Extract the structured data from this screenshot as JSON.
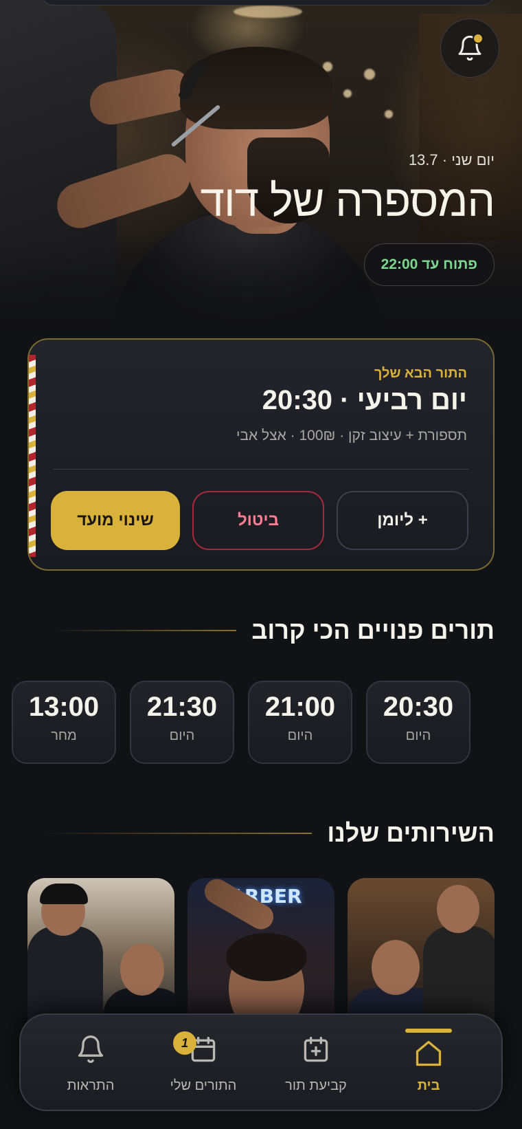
{
  "colors": {
    "accent": "#d8b23a",
    "open_green": "#7bd88f",
    "cancel_red": "#ff7d93",
    "background": "#111216"
  },
  "hero": {
    "date": "יום שני · 13.7",
    "title": "המספרה של דוד",
    "open_status": "פתוח עד 22:00",
    "notification_icon": "bell-icon"
  },
  "next_appointment": {
    "label": "התור הבא שלך",
    "time": "יום רביעי · 20:30",
    "details": "תספורת + עיצוב זקן · 100₪ · אצל אבי",
    "buttons": {
      "calendar": "+ ליומן",
      "cancel": "ביטול",
      "change": "שינוי מועד"
    }
  },
  "available_slots": {
    "title": "תורים פנויים הכי קרוב",
    "slots": [
      {
        "time": "20:30",
        "day": "היום"
      },
      {
        "time": "21:00",
        "day": "היום"
      },
      {
        "time": "21:30",
        "day": "היום"
      },
      {
        "time": "13:00",
        "day": "מחר"
      }
    ]
  },
  "services": {
    "title": "השירותים שלנו",
    "neon_sign": "BARBER"
  },
  "bottom_nav": {
    "items": [
      {
        "label": "בית",
        "icon": "home-icon",
        "active": true
      },
      {
        "label": "קביעת תור",
        "icon": "calendar-plus-icon",
        "active": false
      },
      {
        "label": "התורים שלי",
        "icon": "calendar-icon",
        "active": false,
        "badge": "1"
      },
      {
        "label": "התראות",
        "icon": "bell-icon",
        "active": false
      }
    ]
  }
}
